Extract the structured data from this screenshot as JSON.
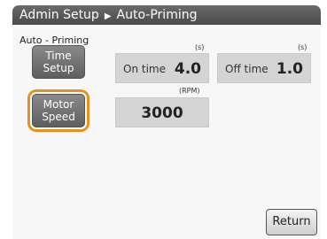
{
  "header": {
    "breadcrumb_root": "Admin Setup",
    "separator": "▶",
    "breadcrumb_current": "Auto-Priming"
  },
  "section_label": "Auto - Priming",
  "side_buttons": {
    "time_setup": {
      "line1": "Time",
      "line2": "Setup"
    },
    "motor_speed": {
      "line1": "Motor",
      "line2": "Speed",
      "selected": true
    }
  },
  "fields": {
    "on_time": {
      "label": "On time",
      "value": "4.0",
      "unit": "(s)"
    },
    "off_time": {
      "label": "Off time",
      "value": "1.0",
      "unit": "(s)"
    },
    "motor_speed": {
      "value": "3000",
      "unit": "(RPM)"
    }
  },
  "footer": {
    "return_label": "Return"
  },
  "colors": {
    "title_bar": "#555555",
    "selection_outline": "#e8901c",
    "field_bg": "#d4d4d4"
  }
}
